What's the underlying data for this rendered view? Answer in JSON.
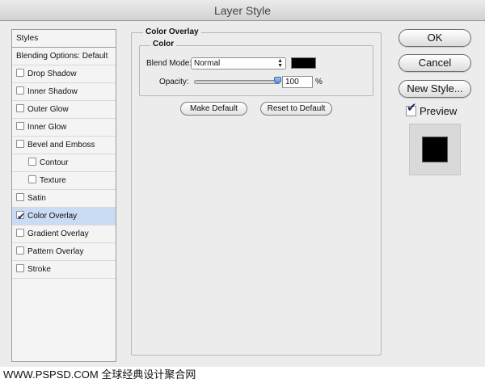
{
  "window": {
    "title": "Layer Style"
  },
  "styles_list": {
    "items": [
      {
        "label": "Styles",
        "checkbox": false,
        "checked": false
      },
      {
        "label": "Blending Options: Default",
        "checkbox": false,
        "checked": false
      },
      {
        "label": "Drop Shadow",
        "checkbox": true,
        "checked": false
      },
      {
        "label": "Inner Shadow",
        "checkbox": true,
        "checked": false
      },
      {
        "label": "Outer Glow",
        "checkbox": true,
        "checked": false
      },
      {
        "label": "Inner Glow",
        "checkbox": true,
        "checked": false
      },
      {
        "label": "Bevel and Emboss",
        "checkbox": true,
        "checked": false
      },
      {
        "label": "Contour",
        "checkbox": true,
        "checked": false
      },
      {
        "label": "Texture",
        "checkbox": true,
        "checked": false
      },
      {
        "label": "Satin",
        "checkbox": true,
        "checked": false
      },
      {
        "label": "Color Overlay",
        "checkbox": true,
        "checked": true
      },
      {
        "label": "Gradient Overlay",
        "checkbox": true,
        "checked": false
      },
      {
        "label": "Pattern Overlay",
        "checkbox": true,
        "checked": false
      },
      {
        "label": "Stroke",
        "checkbox": true,
        "checked": false
      }
    ]
  },
  "panel": {
    "section_title": "Color Overlay",
    "group_title": "Color",
    "blend_mode_label": "Blend Mode:",
    "blend_mode_value": "Normal",
    "overlay_color": "#000000",
    "opacity_label": "Opacity:",
    "opacity_value": "100",
    "opacity_unit": "%",
    "opacity_fraction": 1.0,
    "make_default_label": "Make Default",
    "reset_default_label": "Reset to Default"
  },
  "buttons": {
    "ok_label": "OK",
    "cancel_label": "Cancel",
    "new_style_label": "New Style..."
  },
  "preview": {
    "label": "Preview",
    "checked": true
  },
  "footer": {
    "watermark": "WWW.PSPSD.COM 全球经典设计聚合网"
  }
}
